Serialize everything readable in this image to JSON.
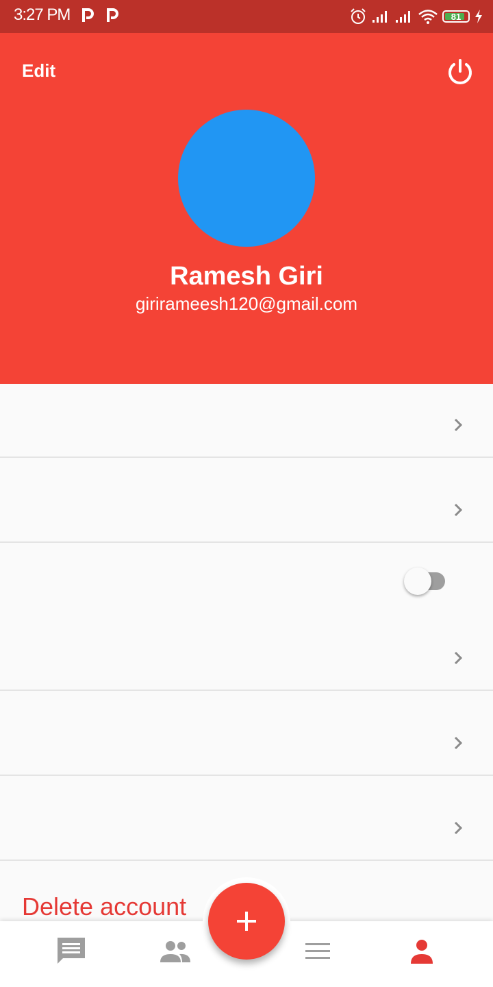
{
  "status_bar": {
    "time": "3:27 PM",
    "battery": "81",
    "icons": [
      "p-notification-icon",
      "p-notification-icon",
      "alarm-icon",
      "signal-icon",
      "signal-icon",
      "wifi-icon",
      "battery-icon",
      "charging-icon"
    ]
  },
  "header": {
    "edit_label": "Edit",
    "power_icon": "power-icon",
    "user_name": "Ramesh Giri",
    "user_email": "girirameesh120@gmail.com",
    "background": "#f44336",
    "avatar_color": "#2196f3"
  },
  "settings": {
    "rows": [
      {
        "label": "",
        "control": "chevron"
      },
      {
        "label": "",
        "control": "chevron"
      },
      {
        "label": "",
        "control": "toggle",
        "on": false
      },
      {
        "label": "",
        "control": "chevron"
      },
      {
        "label": "",
        "control": "chevron"
      },
      {
        "label": "",
        "control": "chevron"
      }
    ]
  },
  "delete_account_label": "Delete account",
  "bottom_nav": {
    "items": [
      {
        "icon": "chat-icon",
        "active": false
      },
      {
        "icon": "people-icon",
        "active": false
      },
      {
        "icon": "menu-icon",
        "active": false
      },
      {
        "icon": "person-icon",
        "active": true
      }
    ],
    "fab_icon": "plus-icon",
    "active_color": "#e53935",
    "inactive_color": "#9e9e9e"
  }
}
